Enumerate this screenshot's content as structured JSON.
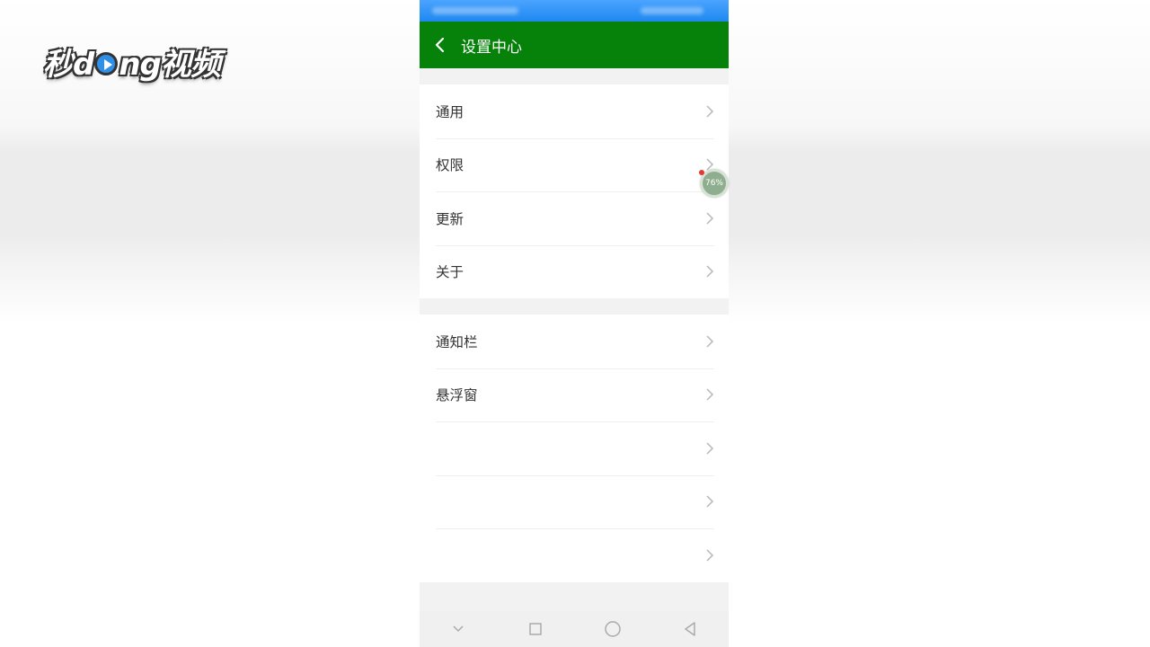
{
  "watermark": {
    "text_prefix": "秒",
    "text_mid": "d",
    "text_mid2": "ng",
    "text_suffix": "视频"
  },
  "app_bar": {
    "title": "设置中心",
    "back_icon": "chevron-left-icon"
  },
  "sections": [
    {
      "items": [
        {
          "label": "通用"
        },
        {
          "label": "权限"
        },
        {
          "label": "更新"
        },
        {
          "label": "关于"
        }
      ]
    },
    {
      "items": [
        {
          "label": "通知栏"
        },
        {
          "label": "悬浮窗"
        },
        {
          "label": "",
          "blurred": true
        },
        {
          "label": "",
          "blurred": true
        },
        {
          "label": "",
          "blurred": true
        }
      ]
    }
  ],
  "floating_ball": {
    "percent": "76%"
  },
  "nav_bar": {
    "icons": [
      "chevron-down-icon",
      "recent-apps-icon",
      "home-icon",
      "back-triangle-icon"
    ]
  },
  "colors": {
    "app_bar": "#06820a",
    "status_bar": "#1e88f0",
    "background": "#f2f2f2"
  }
}
